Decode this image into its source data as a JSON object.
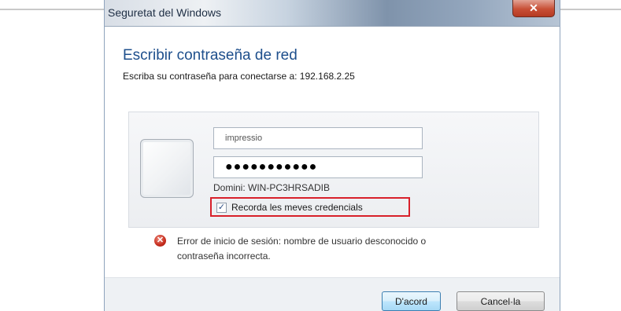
{
  "window": {
    "title": "Seguretat del Windows",
    "close_icon": "close-icon"
  },
  "dialog": {
    "heading": "Escribir contraseña de red",
    "subtext": "Escriba su contraseña para conectarse a: 192.168.2.25"
  },
  "credentials": {
    "avatar_icon": "user-tile-icon",
    "username_value": "impressio",
    "password_value": "●●●●●●●●●●●",
    "domain_text": "Domini: WIN-PC3HRSADIB",
    "remember_label": "Recorda les meves credencials",
    "remember_checked": true,
    "remember_check_glyph": "✓",
    "highlight_color": "#d8202a"
  },
  "error": {
    "icon": "error-icon",
    "icon_glyph": "✕",
    "line1": "Error de inicio de sesión: nombre de usuario desconocido o",
    "line2": "contraseña incorrecta."
  },
  "buttons": {
    "ok_label": "D'acord",
    "cancel_label": "Cancel·la"
  }
}
